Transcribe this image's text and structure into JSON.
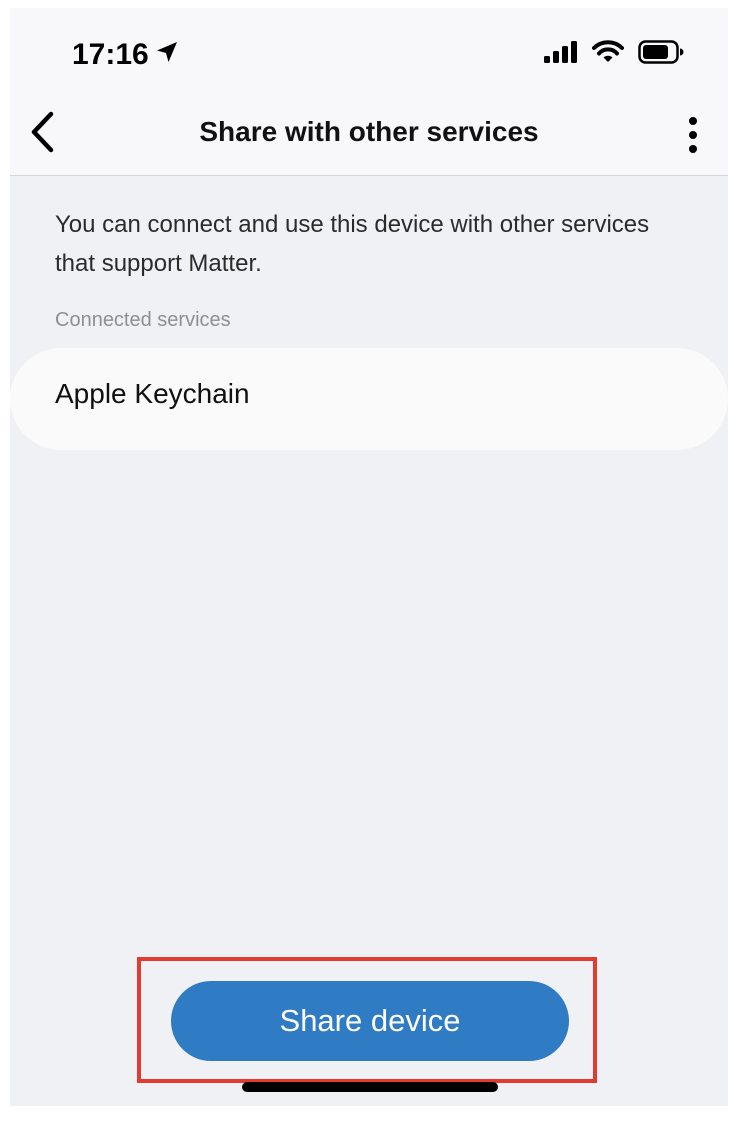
{
  "status_bar": {
    "time": "17:16",
    "icons": [
      "location-arrow-icon",
      "cellular-signal-icon",
      "wifi-icon",
      "battery-icon"
    ]
  },
  "nav": {
    "title": "Share with other services",
    "back_icon": "chevron-left-icon",
    "more_icon": "more-vertical-icon"
  },
  "main": {
    "description": "You can connect and use this device with other services that support Matter.",
    "section_label": "Connected services",
    "services": [
      {
        "name": "Apple Keychain"
      }
    ]
  },
  "actions": {
    "share_label": "Share device"
  },
  "colors": {
    "primary_button": "#2f7bc4",
    "highlight": "#e43b30",
    "background": "#f0f1f5"
  }
}
